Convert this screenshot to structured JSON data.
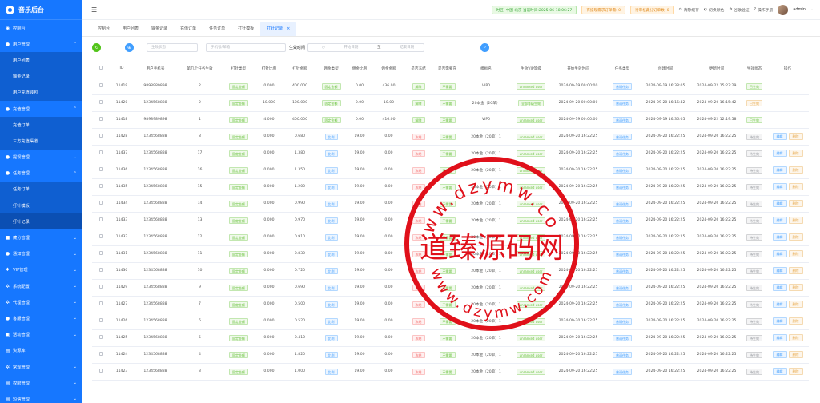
{
  "brand": {
    "title": "音乐后台"
  },
  "sidebar": {
    "items": [
      {
        "label": "控制台",
        "icon": "dashboard-icon",
        "glyph": "◉",
        "chevron": ""
      },
      {
        "label": "用户管理",
        "icon": "user-icon",
        "glyph": "●",
        "chevron": "⌃"
      },
      {
        "label": "用户列表",
        "sub": true
      },
      {
        "label": "输金记录",
        "sub": true
      },
      {
        "label": "用户充值钱包",
        "sub": true
      },
      {
        "label": "充值管理",
        "icon": "wallet-icon",
        "glyph": "●",
        "chevron": "⌃"
      },
      {
        "label": "充值订单",
        "sub": true
      },
      {
        "label": "三方充值渠道",
        "sub": true
      },
      {
        "label": "提现管理",
        "icon": "withdraw-icon",
        "glyph": "●",
        "chevron": "⌄"
      },
      {
        "label": "任务管理",
        "icon": "task-icon",
        "glyph": "●",
        "chevron": "⌃"
      },
      {
        "label": "任务订单",
        "sub": true
      },
      {
        "label": "打针模板",
        "sub": true
      },
      {
        "label": "打针记录",
        "sub": true,
        "active": true
      },
      {
        "label": "藏分管理",
        "icon": "music-icon",
        "glyph": "■",
        "chevron": "⌄"
      },
      {
        "label": "通知管理",
        "icon": "bell-icon",
        "glyph": "●",
        "chevron": "⌄"
      },
      {
        "label": "VIP管理",
        "icon": "vip-icon",
        "glyph": "♦",
        "chevron": "⌄"
      },
      {
        "label": "系统配置",
        "icon": "gear-icon",
        "glyph": "✲",
        "chevron": "⌄"
      },
      {
        "label": "代理管理",
        "icon": "agent-icon",
        "glyph": "✲",
        "chevron": "⌄"
      },
      {
        "label": "客服管理",
        "icon": "service-icon",
        "glyph": "●",
        "chevron": "⌄"
      },
      {
        "label": "活动管理",
        "icon": "activity-icon",
        "glyph": "▣",
        "chevron": "⌄"
      },
      {
        "label": "资源库",
        "icon": "folder-icon",
        "glyph": "▤",
        "chevron": ""
      },
      {
        "label": "常规管理",
        "icon": "settings-icon",
        "glyph": "✲",
        "chevron": "⌄"
      },
      {
        "label": "权限管理",
        "icon": "lock-icon",
        "glyph": "▤",
        "chevron": "⌄"
      },
      {
        "label": "短信管理",
        "icon": "sms-icon",
        "glyph": "▤",
        "chevron": "⌄"
      }
    ]
  },
  "header": {
    "pill_green": "时区: 中国 北京 当前时间:2025-06-18 06:27",
    "pill_orange1": "有提现需求订单需: 0",
    "pill_orange2": "待审核藏分订单数: 0",
    "clear_cache": "清除缓存",
    "switch_color": "切换颜色",
    "google_verify": "谷歌验证",
    "manual": "操作手册",
    "username": "admin"
  },
  "tabs": [
    {
      "label": "控制台"
    },
    {
      "label": "用户列表"
    },
    {
      "label": "输金记录"
    },
    {
      "label": "充值订单"
    },
    {
      "label": "任务订单"
    },
    {
      "label": "打针模板"
    },
    {
      "label": "打针记录",
      "active": true,
      "close": "×"
    }
  ],
  "filter": {
    "status_placeholder": "生效状态",
    "phone_placeholder": "手机号/邮箱",
    "time_label": "生效时间",
    "start_placeholder": "开始日期",
    "range_sep": "至",
    "end_placeholder": "结束日期"
  },
  "table": {
    "headers": [
      "ID",
      "用户手机号",
      "第几个任务生效",
      "打针类型",
      "打针比例",
      "打针金额",
      "佣金类型",
      "佣金比例",
      "佣金金额",
      "是否冻结",
      "是否需要充",
      "模板名",
      "生效VIP等级",
      "开始生效时间",
      "任务类型",
      "创建时间",
      "更新时间",
      "生效状态",
      "操作"
    ],
    "rows": [
      [
        "11419",
        "9898989898",
        "2",
        "固定金额",
        "0.000",
        "400.000",
        "固定金额",
        "0.00",
        "436.00",
        "解除",
        "不需要",
        "VIP0",
        "unranked user",
        "2024-09-19 00:00:00",
        "普通任务",
        "2024-09-19 16:38:05",
        "2024-09-22 15:27:29",
        "已生效",
        ""
      ],
      [
        "11420",
        "1234568888",
        "2",
        "固定金额",
        "10.000",
        "100.000",
        "固定金额",
        "0.00",
        "10.00",
        "解除",
        "不需要",
        "20本金（20单）",
        "全部等级生效",
        "2024-09-20 00:00:00",
        "普通任务",
        "2024-09-20 16:15:42",
        "2024-09-20 16:15:42",
        "已生效",
        ""
      ],
      [
        "11418",
        "9898989898",
        "1",
        "固定金额",
        "4.000",
        "400.000",
        "固定金额",
        "0.00",
        "416.00",
        "解除",
        "不需要",
        "VIP0",
        "unranked user",
        "2024-09-19 00:00:00",
        "普通任务",
        "2024-09-19 16:36:05",
        "2024-09-22 12:19:58",
        "已生效",
        ""
      ],
      [
        "11428",
        "1234568888",
        "8",
        "固定金额",
        "0.000",
        "0.680",
        "比例",
        "19.00",
        "0.00",
        "冻结",
        "不需要",
        "20本金（20单）1",
        "unranked user",
        "2024-09-20 16:22:25",
        "普通任务",
        "2024-09-20 16:22:25",
        "2024-09-20 16:22:25",
        "待生效",
        "op"
      ],
      [
        "11437",
        "1234568888",
        "17",
        "固定金额",
        "0.000",
        "1.380",
        "比例",
        "19.00",
        "0.00",
        "冻结",
        "不需要",
        "20本金（20单）1",
        "unranked user",
        "2024-09-20 16:22:25",
        "普通任务",
        "2024-09-20 16:22:25",
        "2024-09-20 16:22:25",
        "待生效",
        "op"
      ],
      [
        "11436",
        "1234568888",
        "16",
        "固定金额",
        "0.000",
        "1.350",
        "比例",
        "19.00",
        "0.00",
        "冻结",
        "不需要",
        "20本金（20单）1",
        "unranked user",
        "2024-09-20 16:22:25",
        "普通任务",
        "2024-09-20 16:22:25",
        "2024-09-20 16:22:25",
        "待生效",
        "op"
      ],
      [
        "11435",
        "1234568888",
        "15",
        "固定金额",
        "0.000",
        "1.200",
        "比例",
        "19.00",
        "0.00",
        "冻结",
        "不需要",
        "20本金（20单）1",
        "unranked user",
        "2024-09-20 16:22:25",
        "普通任务",
        "2024-09-20 16:22:25",
        "2024-09-20 16:22:25",
        "待生效",
        "op"
      ],
      [
        "11434",
        "1234568888",
        "14",
        "固定金额",
        "0.000",
        "0.990",
        "比例",
        "19.00",
        "0.00",
        "冻结",
        "不需要",
        "20本金（20单）1",
        "unranked user",
        "2024-09-20 16:22:25",
        "普通任务",
        "2024-09-20 16:22:25",
        "2024-09-20 16:22:25",
        "待生效",
        "op"
      ],
      [
        "11433",
        "1234568888",
        "13",
        "固定金额",
        "0.000",
        "0.970",
        "比例",
        "19.00",
        "0.00",
        "冻结",
        "不需要",
        "20本金（20单）1",
        "unranked user",
        "2024-09-20 16:22:25",
        "普通任务",
        "2024-09-20 16:22:25",
        "2024-09-20 16:22:25",
        "待生效",
        "op"
      ],
      [
        "11432",
        "1234568888",
        "12",
        "固定金额",
        "0.000",
        "0.910",
        "比例",
        "19.00",
        "0.00",
        "冻结",
        "不需要",
        "20本金（20单）1",
        "unranked user",
        "2024-09-20 16:22:25",
        "普通任务",
        "2024-09-20 16:22:25",
        "2024-09-20 16:22:25",
        "待生效",
        "op"
      ],
      [
        "11431",
        "1234568888",
        "11",
        "固定金额",
        "0.000",
        "0.830",
        "比例",
        "19.00",
        "0.00",
        "冻结",
        "不需要",
        "20本金（20单）1",
        "unranked user",
        "2024-09-20 16:22:25",
        "普通任务",
        "2024-09-20 16:22:25",
        "2024-09-20 16:22:25",
        "待生效",
        "op"
      ],
      [
        "11430",
        "1234568888",
        "10",
        "固定金额",
        "0.000",
        "0.720",
        "比例",
        "19.00",
        "0.00",
        "冻结",
        "不需要",
        "20本金（20单）1",
        "unranked user",
        "2024-09-20 16:22:25",
        "普通任务",
        "2024-09-20 16:22:25",
        "2024-09-20 16:22:25",
        "待生效",
        "op"
      ],
      [
        "11429",
        "1234568888",
        "9",
        "固定金额",
        "0.000",
        "0.690",
        "比例",
        "19.00",
        "0.00",
        "冻结",
        "不需要",
        "20本金（20单）1",
        "unranked user",
        "2024-09-20 16:22:25",
        "普通任务",
        "2024-09-20 16:22:25",
        "2024-09-20 16:22:25",
        "待生效",
        "op"
      ],
      [
        "11427",
        "1234568888",
        "7",
        "固定金额",
        "0.000",
        "0.500",
        "比例",
        "19.00",
        "0.00",
        "冻结",
        "不需要",
        "20本金（20单）1",
        "unranked user",
        "2024-09-20 16:22:25",
        "普通任务",
        "2024-09-20 16:22:25",
        "2024-09-20 16:22:25",
        "待生效",
        "op"
      ],
      [
        "11426",
        "1234568888",
        "6",
        "固定金额",
        "0.000",
        "0.520",
        "比例",
        "19.00",
        "0.00",
        "冻结",
        "不需要",
        "20本金（20单）1",
        "unranked user",
        "2024-09-20 16:22:25",
        "普通任务",
        "2024-09-20 16:22:25",
        "2024-09-20 16:22:25",
        "待生效",
        "op"
      ],
      [
        "11425",
        "1234568888",
        "5",
        "固定金额",
        "0.000",
        "0.410",
        "比例",
        "19.00",
        "0.00",
        "冻结",
        "不需要",
        "20本金（20单）1",
        "unranked user",
        "2024-09-20 16:22:25",
        "普通任务",
        "2024-09-20 16:22:25",
        "2024-09-20 16:22:25",
        "待生效",
        "op"
      ],
      [
        "11424",
        "1234568888",
        "4",
        "固定金额",
        "0.000",
        "1.820",
        "比例",
        "19.00",
        "0.00",
        "冻结",
        "不需要",
        "20本金（20单）1",
        "unranked user",
        "2024-09-20 16:22:25",
        "普通任务",
        "2024-09-20 16:22:25",
        "2024-09-20 16:22:25",
        "待生效",
        "op"
      ],
      [
        "11423",
        "1234568888",
        "3",
        "固定金额",
        "0.000",
        "1.000",
        "比例",
        "19.00",
        "0.00",
        "冻结",
        "不需要",
        "20本金（20单）1",
        "unranked user",
        "2024-09-20 16:22:25",
        "普通任务",
        "2024-09-20 16:22:25",
        "2024-09-20 16:22:25",
        "待生效",
        "op"
      ]
    ],
    "edit_label": "编辑",
    "delete_label": "删除"
  },
  "watermark": {
    "text": "道臻源码网",
    "top_arc": "www.dzymw.com",
    "bottom_arc": "www.dzymw.com",
    "color": "#e0101a"
  }
}
